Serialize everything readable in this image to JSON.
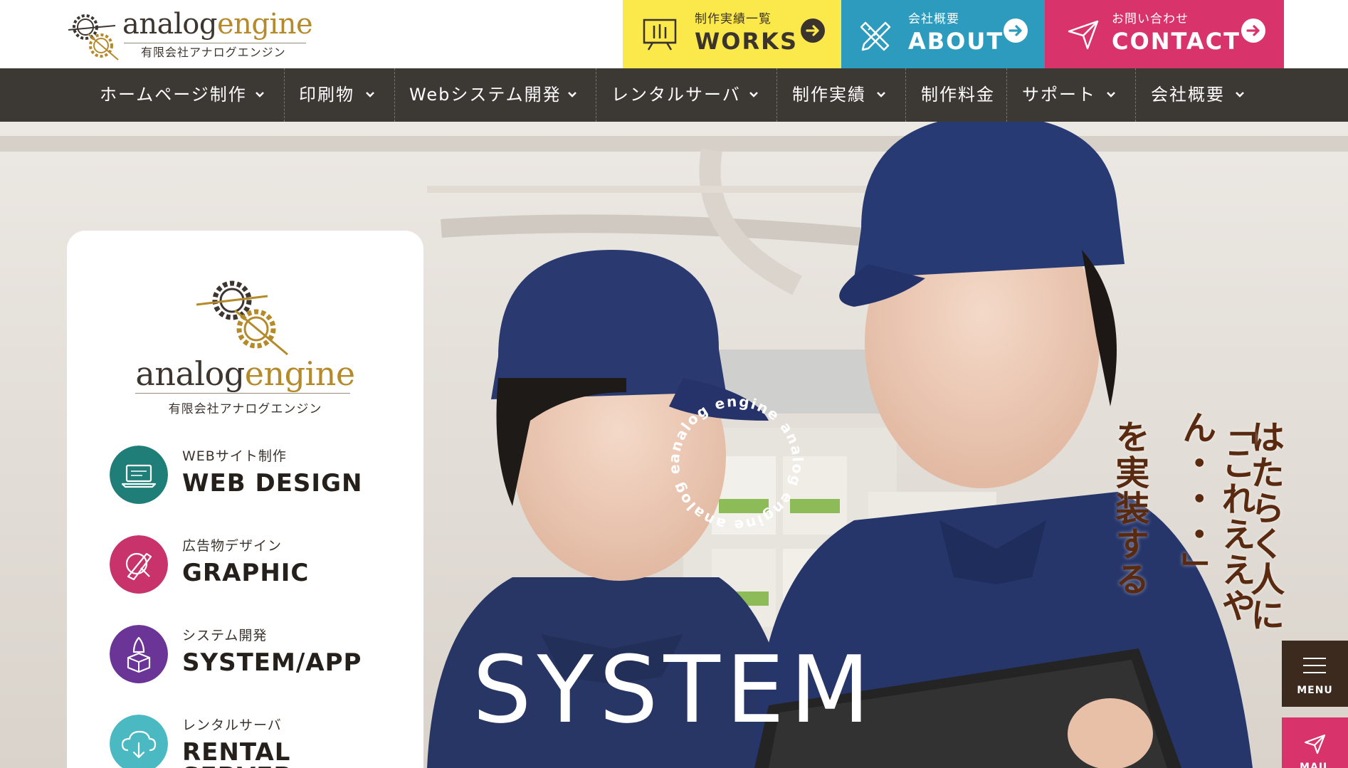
{
  "header": {
    "logo": {
      "text_a": "analog",
      "text_b": "engine",
      "sub": "有限会社アナログエンジン"
    },
    "buttons": [
      {
        "sub": "制作実績一覧",
        "main": "WORKS",
        "icon": "easel-icon"
      },
      {
        "sub": "会社概要",
        "main": "ABOUT",
        "icon": "pencil-ruler-icon"
      },
      {
        "sub": "お問い合わせ",
        "main": "CONTACT",
        "icon": "paper-plane-icon"
      }
    ]
  },
  "nav": {
    "items": [
      {
        "label": "ホームページ制作",
        "dropdown": true
      },
      {
        "label": "印刷物",
        "dropdown": true
      },
      {
        "label": "Webシステム開発",
        "dropdown": true
      },
      {
        "label": "レンタルサーバ",
        "dropdown": true
      },
      {
        "label": "制作実績",
        "dropdown": true
      },
      {
        "label": "制作料金",
        "dropdown": false
      },
      {
        "label": "サポート",
        "dropdown": true
      },
      {
        "label": "会社概要",
        "dropdown": true
      }
    ]
  },
  "hero": {
    "tagline": [
      "はたらく人に",
      "「これええやん・・・」",
      "を実装する"
    ],
    "circle_text": "analog engine analog engine analog engine",
    "big_word": "SYSTEM"
  },
  "card": {
    "logo": {
      "text_a": "analog",
      "text_b": "engine",
      "sub": "有限会社アナログエンジン"
    },
    "services": [
      {
        "sub": "WEBサイト制作",
        "main": "WEB DESIGN",
        "color": "#1f7e78",
        "icon": "laptop-icon"
      },
      {
        "sub": "広告物デザイン",
        "main": "GRAPHIC",
        "color": "#c8336b",
        "icon": "brush-icon"
      },
      {
        "sub": "システム開発",
        "main": "SYSTEM/APP",
        "color": "#6a3596",
        "icon": "rocket-box-icon"
      },
      {
        "sub": "レンタルサーバ",
        "main": "RENTAL SERVER",
        "color": "#4bb9c2",
        "icon": "cloud-download-icon"
      }
    ]
  },
  "side": {
    "menu_label": "MENU",
    "mail_label": "MAIL"
  }
}
